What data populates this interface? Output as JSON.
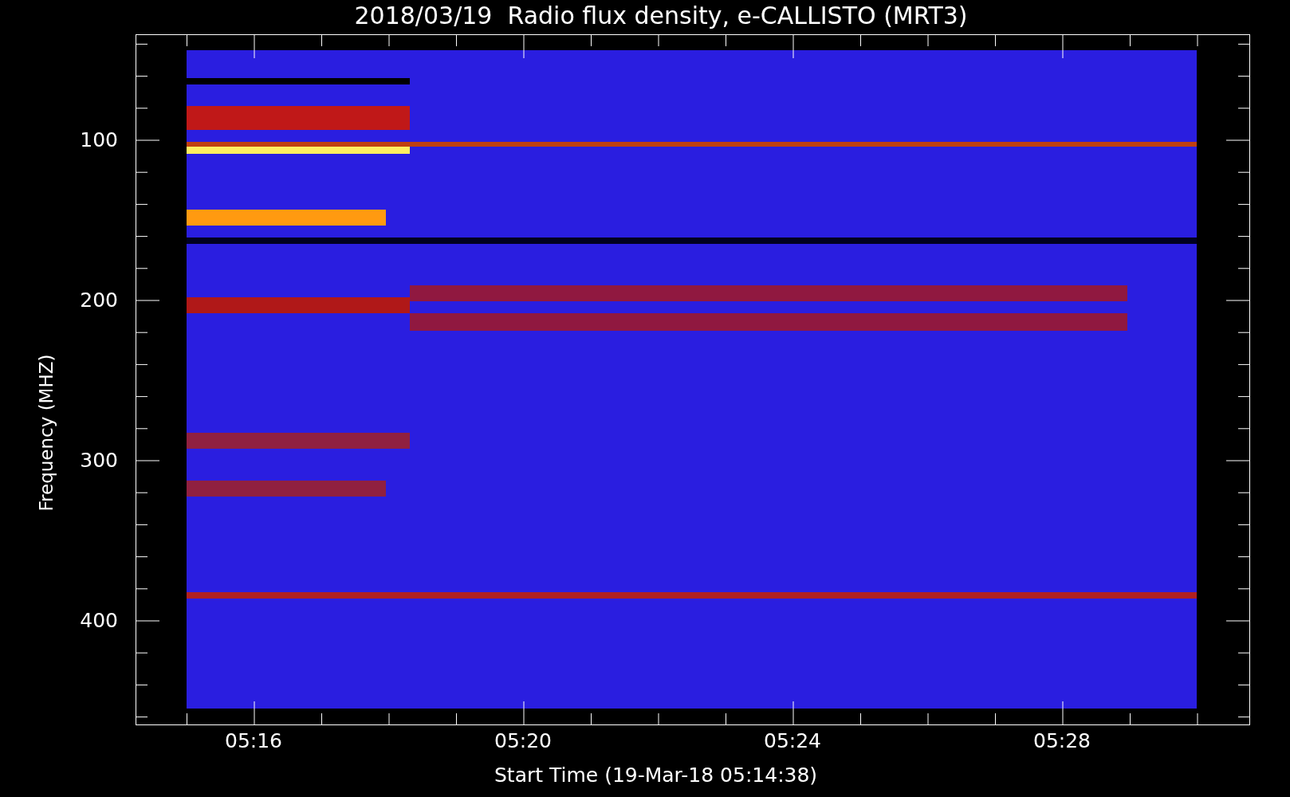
{
  "title": "2018/03/19  Radio flux density, e-CALLISTO (MRT3)",
  "y_axis": {
    "label": "Frequency (MHZ)",
    "ticks": [
      "100",
      "200",
      "300",
      "400"
    ]
  },
  "x_axis": {
    "label": "Start Time (19-Mar-18 05:14:38)",
    "ticks": [
      "05:16",
      "05:20",
      "05:24",
      "05:28"
    ]
  }
}
